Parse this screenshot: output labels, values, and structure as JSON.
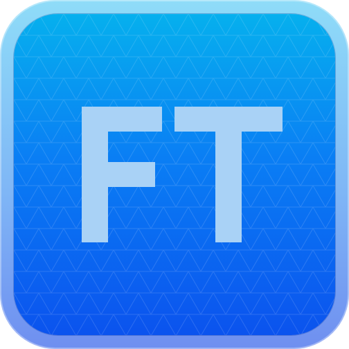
{
  "app_icon": {
    "monogram": {
      "first_letter": "F",
      "second_letter": "T"
    },
    "colors": {
      "frame_top": "#8fdcf8",
      "frame_bottom": "#6f8ff0",
      "face_top": "#06b0ee",
      "face_bottom": "#0b53ee",
      "letter_fill": "#a9d2f6"
    }
  }
}
